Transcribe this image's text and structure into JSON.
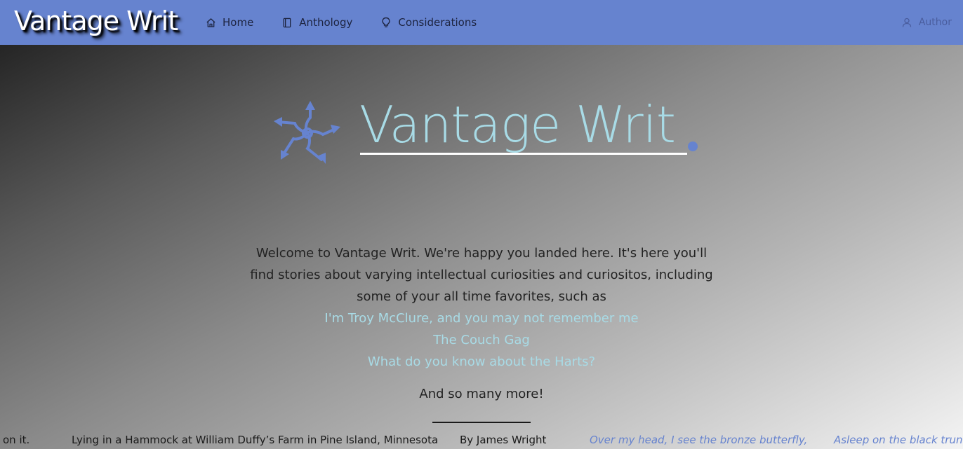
{
  "navbar": {
    "brand": "Vantage Writ",
    "items": [
      {
        "label": "Home",
        "icon": "home-icon"
      },
      {
        "label": "Anthology",
        "icon": "book-icon"
      },
      {
        "label": "Considerations",
        "icon": "lightbulb-icon"
      }
    ],
    "author": {
      "label": "Author",
      "icon": "user-icon"
    }
  },
  "hero": {
    "title": "Vantage Writ",
    "intro": "Welcome to Vantage Writ. We're happy you landed here. It's here you'll find stories about varying intellectual curiosities and curiositos, including some of your all time favorites, such as",
    "links": [
      "I'm Troy McClure, and you may not remember me",
      "The Couch Gag",
      "What do you know about the Harts?"
    ],
    "more": "And so many more!"
  },
  "ticker": {
    "tail": "on it.",
    "poem_title": "Lying in a Hammock at William Duffy’s Farm in Pine Island, Minnesota",
    "byline": "By James Wright",
    "line1": "Over my head, I see the bronze butterfly,",
    "line2": "Asleep on the black trunk,"
  },
  "colors": {
    "nav_bg": "#6683cf",
    "accent_light": "#a8dbe6",
    "accent": "#6683cf"
  }
}
